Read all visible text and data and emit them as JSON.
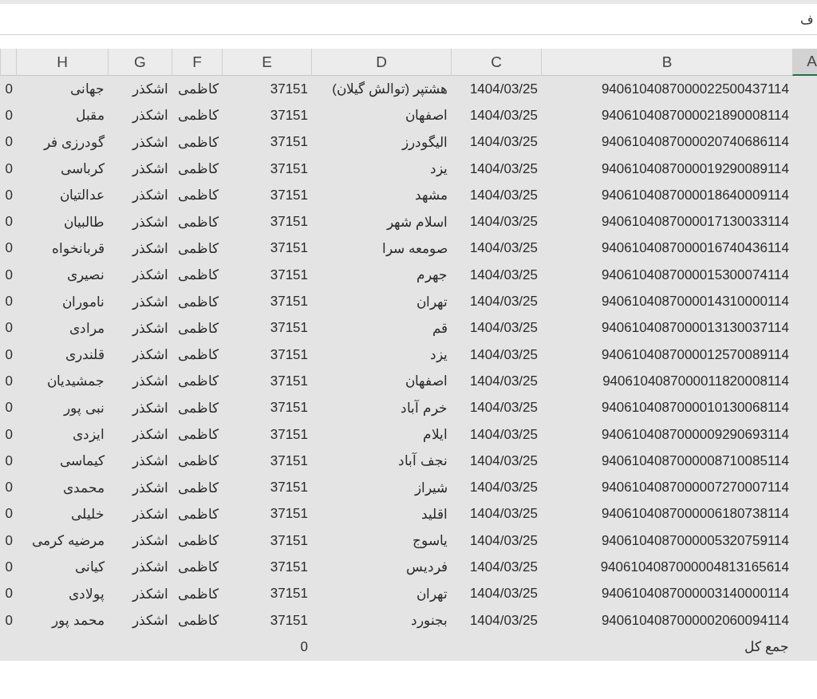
{
  "formula_bar": {
    "text": "ف"
  },
  "columns": [
    {
      "label": "A",
      "selected": true
    },
    {
      "label": "B",
      "selected": false
    },
    {
      "label": "C",
      "selected": false
    },
    {
      "label": "D",
      "selected": false
    },
    {
      "label": "E",
      "selected": false
    },
    {
      "label": "F",
      "selected": false
    },
    {
      "label": "G",
      "selected": false
    },
    {
      "label": "H",
      "selected": false
    }
  ],
  "rows": [
    {
      "cells": [
        "9406104087000022500437114",
        "1404/03/25",
        "هشتپر (توالش گیلان)",
        "37151",
        "کاظمی",
        "اشکذر",
        "جهانی",
        "0"
      ]
    },
    {
      "cells": [
        "9406104087000021890008114",
        "1404/03/25",
        "اصفهان",
        "37151",
        "کاظمی",
        "اشکذر",
        "مقبل",
        "0"
      ]
    },
    {
      "cells": [
        "9406104087000020740686114",
        "1404/03/25",
        "الیگودرز",
        "37151",
        "کاظمی",
        "اشکذر",
        "گودرزی فر",
        "0"
      ]
    },
    {
      "cells": [
        "9406104087000019290089114",
        "1404/03/25",
        "یزد",
        "37151",
        "کاظمی",
        "اشکذر",
        "کرباسی",
        "0"
      ]
    },
    {
      "cells": [
        "9406104087000018640009114",
        "1404/03/25",
        "مشهد",
        "37151",
        "کاظمی",
        "اشکذر",
        "عدالتیان",
        "0"
      ]
    },
    {
      "cells": [
        "9406104087000017130033114",
        "1404/03/25",
        "اسلام شهر",
        "37151",
        "کاظمی",
        "اشکذر",
        "طالبیان",
        "0"
      ]
    },
    {
      "cells": [
        "9406104087000016740436114",
        "1404/03/25",
        "صومعه سرا",
        "37151",
        "کاظمی",
        "اشکذر",
        "قربانخواه",
        "0"
      ]
    },
    {
      "cells": [
        "9406104087000015300074114",
        "1404/03/25",
        "جهرم",
        "37151",
        "کاظمی",
        "اشکذر",
        "نصیری",
        "0"
      ]
    },
    {
      "cells": [
        "9406104087000014310000114",
        "1404/03/25",
        "تهران",
        "37151",
        "کاظمی",
        "اشکذر",
        "ناموران",
        "0"
      ]
    },
    {
      "cells": [
        "9406104087000013130037114",
        "1404/03/25",
        "قم",
        "37151",
        "کاظمی",
        "اشکذر",
        "مرادی",
        "0"
      ]
    },
    {
      "cells": [
        "9406104087000012570089114",
        "1404/03/25",
        "یزد",
        "37151",
        "کاظمی",
        "اشکذر",
        "قلندری",
        "0"
      ]
    },
    {
      "cells": [
        "9406104087000011820008114",
        "1404/03/25",
        "اصفهان",
        "37151",
        "کاظمی",
        "اشکذر",
        "جمشیدیان",
        "0"
      ]
    },
    {
      "cells": [
        "9406104087000010130068114",
        "1404/03/25",
        "خرم آباد",
        "37151",
        "کاظمی",
        "اشکذر",
        "نبی پور",
        "0"
      ]
    },
    {
      "cells": [
        "9406104087000009290693114",
        "1404/03/25",
        "ایلام",
        "37151",
        "کاظمی",
        "اشکذر",
        "ایزدی",
        "0"
      ]
    },
    {
      "cells": [
        "9406104087000008710085114",
        "1404/03/25",
        "نجف آباد",
        "37151",
        "کاظمی",
        "اشکذر",
        "کیماسی",
        "0"
      ]
    },
    {
      "cells": [
        "9406104087000007270007114",
        "1404/03/25",
        "شیراز",
        "37151",
        "کاظمی",
        "اشکذر",
        "محمدی",
        "0"
      ]
    },
    {
      "cells": [
        "9406104087000006180738114",
        "1404/03/25",
        "اقلید",
        "37151",
        "کاظمی",
        "اشکذر",
        "خلیلی",
        "0"
      ]
    },
    {
      "cells": [
        "9406104087000005320759114",
        "1404/03/25",
        "یاسوج",
        "37151",
        "کاظمی",
        "اشکذر",
        "مرضیه کرمی",
        "0"
      ]
    },
    {
      "cells": [
        "9406104087000004813165614",
        "1404/03/25",
        "فردیس",
        "37151",
        "کاظمی",
        "اشکذر",
        "کیانی",
        "0"
      ]
    },
    {
      "cells": [
        "9406104087000003140000114",
        "1404/03/25",
        "تهران",
        "37151",
        "کاظمی",
        "اشکذر",
        "پولادی",
        "0"
      ]
    },
    {
      "cells": [
        "9406104087000002060094114",
        "1404/03/25",
        "بجنورد",
        "37151",
        "کاظمی",
        "اشکذر",
        "محمد پور",
        "0"
      ]
    }
  ],
  "total": {
    "label": "جمع کل",
    "value": "0"
  }
}
